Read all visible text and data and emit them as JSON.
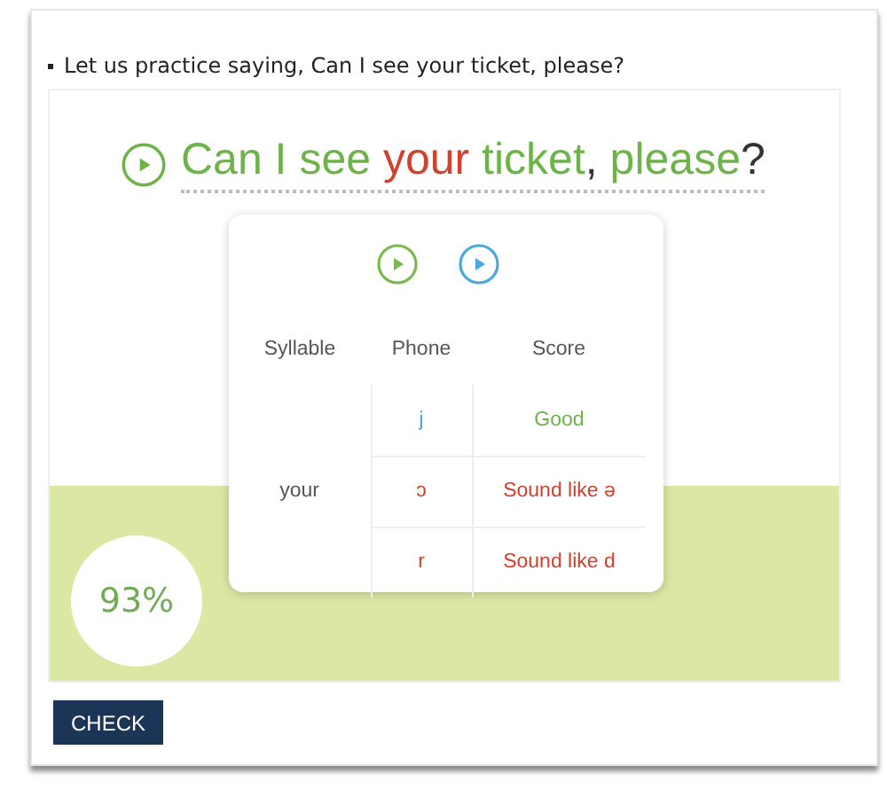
{
  "instruction": "Let us practice saying, Can I see your ticket, please?",
  "sentence": [
    {
      "text": "Can I see",
      "kind": "good"
    },
    {
      "text": " your",
      "kind": "bad"
    },
    {
      "text": " ticket",
      "kind": "good"
    },
    {
      "text": ",",
      "kind": "plain"
    },
    {
      "text": " please",
      "kind": "good"
    },
    {
      "text": "?",
      "kind": "plain"
    }
  ],
  "popup": {
    "columns": [
      "Syllable",
      "Phone",
      "Score"
    ],
    "syllables": [
      {
        "syllable": "your",
        "phones": [
          {
            "phone": "j",
            "score": "Good",
            "kind": "good"
          },
          {
            "phone": "ɔ",
            "score": "Sound like ə",
            "kind": "bad"
          },
          {
            "phone": "r",
            "score": "Sound like d",
            "kind": "bad"
          }
        ]
      }
    ]
  },
  "score": "93%",
  "button": "CHECK"
}
